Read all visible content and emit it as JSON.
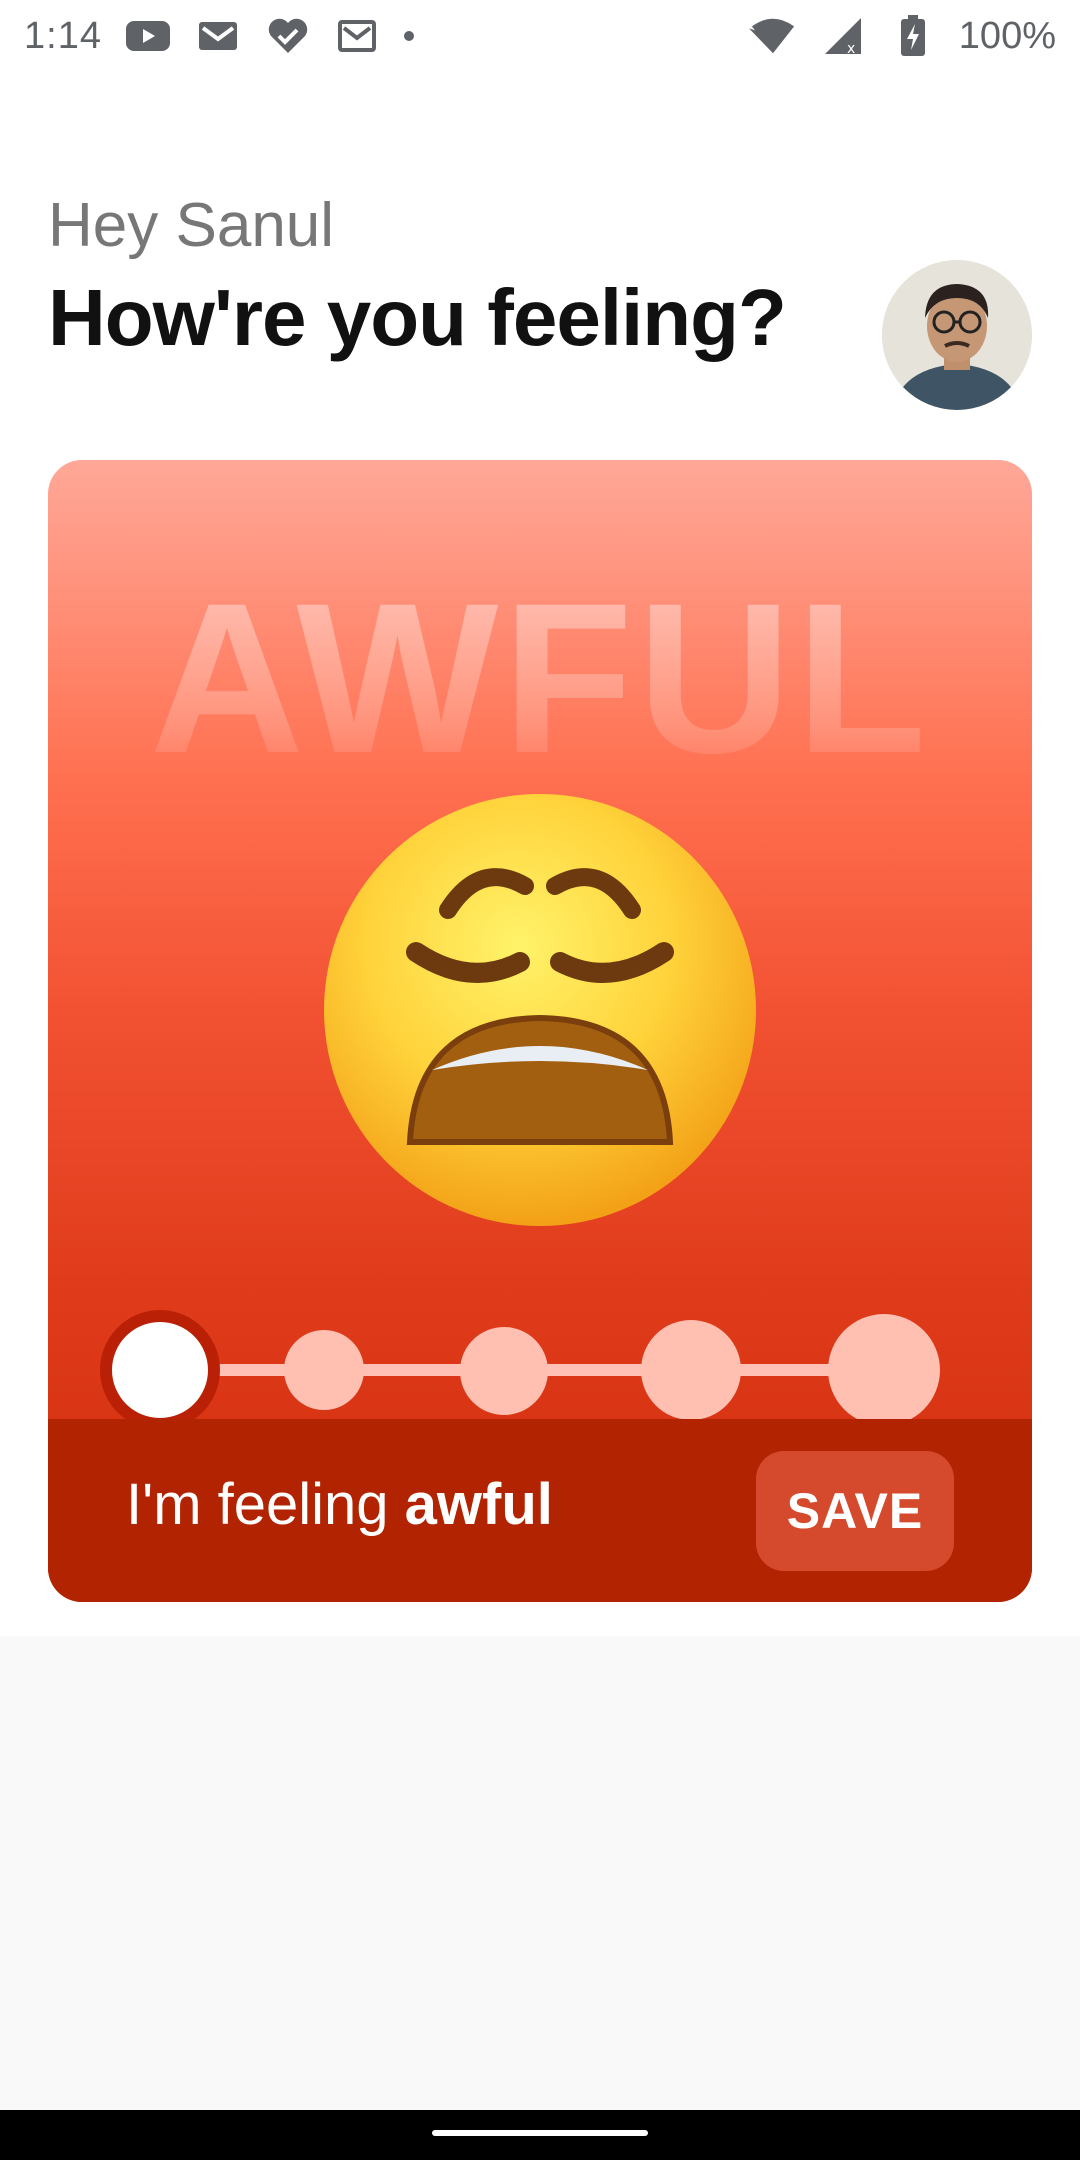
{
  "status_bar": {
    "time": "1:14",
    "battery": "100%",
    "icons": [
      "youtube-icon",
      "gmail-icon",
      "health-heart-icon",
      "gmail-icon",
      "dot-icon",
      "wifi-icon",
      "signal-icon",
      "battery-charging-icon"
    ]
  },
  "header": {
    "greeting": "Hey Sanul",
    "question": "How're you feeling?"
  },
  "mood": {
    "watermark": "AWFUL",
    "emoji": "weary-face-emoji",
    "selected_step": 1,
    "total_steps": 5,
    "feeling_prefix": "I'm feeling",
    "feeling_value": "awful",
    "save_label": "SAVE"
  },
  "colors": {
    "card_top": "#ffa898",
    "card_bottom": "#cf2c0a",
    "footer": "#b22302",
    "save_button": "#d54a2c",
    "slider_inactive": "#ffbfb1",
    "slider_selected_ring": "#b92006"
  }
}
